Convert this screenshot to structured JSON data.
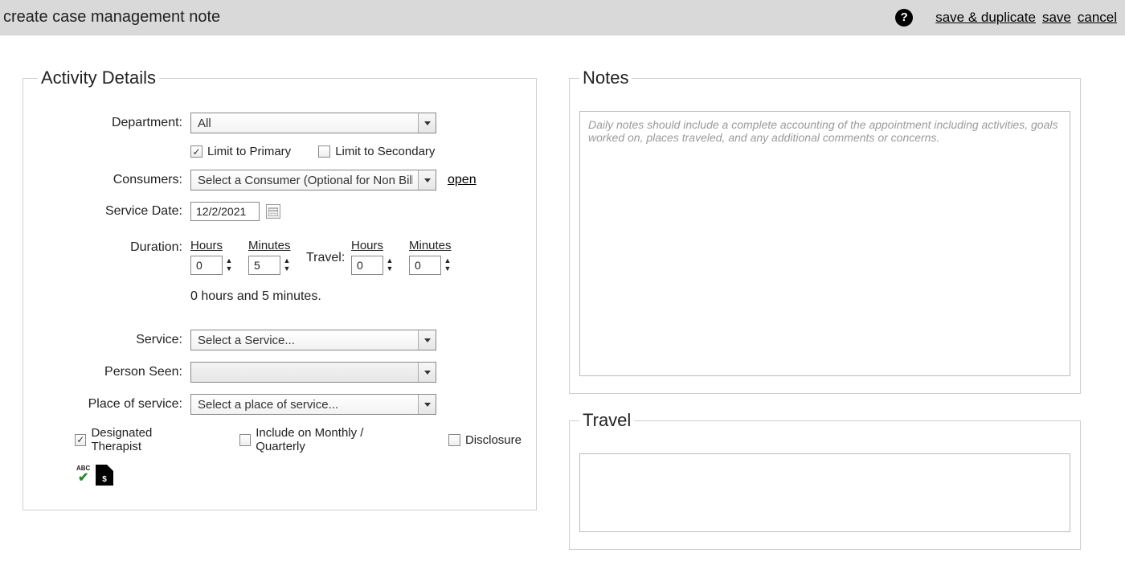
{
  "header": {
    "title": "create case management note",
    "links": {
      "save_duplicate": "save & duplicate",
      "save": "save",
      "cancel": "cancel"
    }
  },
  "activity": {
    "legend": "Activity Details",
    "department_label": "Department:",
    "department_value": "All",
    "limit_primary_label": "Limit to Primary",
    "limit_primary_checked": true,
    "limit_secondary_label": "Limit to Secondary",
    "limit_secondary_checked": false,
    "consumers_label": "Consumers:",
    "consumers_value": "Select a Consumer (Optional for Non Bill",
    "open_link": "open",
    "service_date_label": "Service Date:",
    "service_date_value": "12/2/2021",
    "duration_label": "Duration:",
    "travel_label": "Travel:",
    "hours_head": "Hours",
    "minutes_head": "Minutes",
    "duration_hours": "0",
    "duration_minutes": "5",
    "travel_hours": "0",
    "travel_minutes": "0",
    "duration_summary": "0 hours and 5 minutes.",
    "service_label": "Service:",
    "service_value": "Select a Service...",
    "person_seen_label": "Person Seen:",
    "person_seen_value": "",
    "place_label": "Place of service:",
    "place_value": "Select a place of service...",
    "designated_therapist_label": "Designated Therapist",
    "designated_therapist_checked": true,
    "include_monthly_label": "Include on Monthly / Quarterly",
    "include_monthly_checked": false,
    "disclosure_label": "Disclosure",
    "disclosure_checked": false
  },
  "notes": {
    "legend": "Notes",
    "placeholder": "Daily notes should include a complete accounting of the appointment including activities, goals worked on, places traveled, and any additional comments or concerns."
  },
  "travel": {
    "legend": "Travel"
  },
  "icons": {
    "help": "?",
    "abc": "ABC",
    "dollar": "$"
  }
}
